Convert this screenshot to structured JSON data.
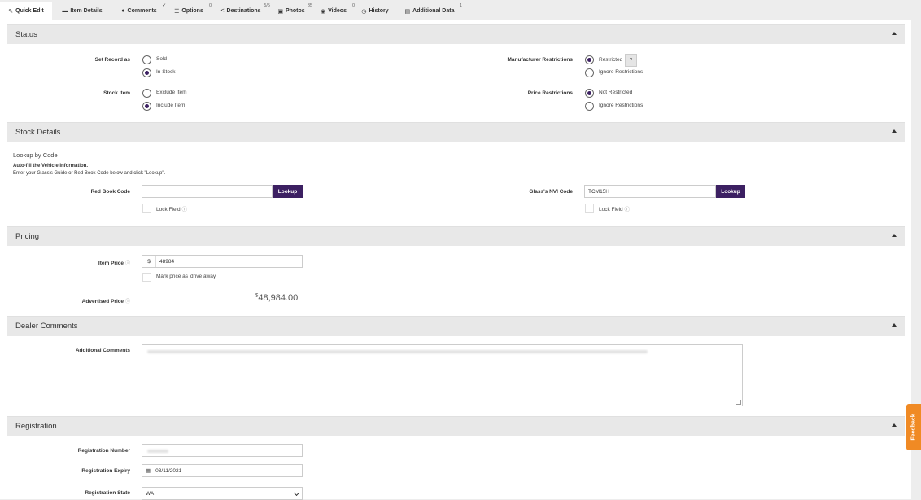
{
  "tabs": [
    {
      "label": "Quick Edit",
      "icon": "edit-icon",
      "glyph": "✎",
      "badge": ""
    },
    {
      "label": "Item Details",
      "icon": "car-icon",
      "glyph": "▬",
      "badge": ""
    },
    {
      "label": "Comments",
      "icon": "comment-icon",
      "glyph": "●",
      "badge": "✔"
    },
    {
      "label": "Options",
      "icon": "list-icon",
      "glyph": "☰",
      "badge": "0"
    },
    {
      "label": "Destinations",
      "icon": "share-icon",
      "glyph": "<",
      "badge": "5/5"
    },
    {
      "label": "Photos",
      "icon": "image-icon",
      "glyph": "▣",
      "badge": "35"
    },
    {
      "label": "Videos",
      "icon": "play-icon",
      "glyph": "◉",
      "badge": "0"
    },
    {
      "label": "History",
      "icon": "clock-icon",
      "glyph": "◷",
      "badge": ""
    },
    {
      "label": "Additional Data",
      "icon": "data-icon",
      "glyph": "▤",
      "badge": "1"
    }
  ],
  "status": {
    "title": "Status",
    "set_record_label": "Set Record as",
    "sold": "Sold",
    "in_stock": "In Stock",
    "stock_item_label": "Stock Item",
    "exclude_item": "Exclude Item",
    "include_item": "Include Item",
    "manufacturer_label": "Manufacturer Restrictions",
    "restricted": "Restricted",
    "help": "?",
    "ignore_restrictions": "Ignore Restrictions",
    "price_label": "Price Restrictions",
    "not_restricted": "Not Restricted",
    "price_ignore_restrictions": "Ignore Restrictions"
  },
  "stock_details": {
    "title": "Stock Details",
    "lookup_heading": "Lookup by Code",
    "autofill_bold": "Auto-fill the Vehicle Information.",
    "autofill_text": "Enter your Glass's Guide or Red Book Code below and click \"Lookup\".",
    "red_book_label": "Red Book Code",
    "red_book_value": "",
    "lookup": "Lookup",
    "lock_field": "Lock Field",
    "nvi_label": "Glass's NVI Code",
    "nvi_value": "TCM15H"
  },
  "pricing": {
    "title": "Pricing",
    "item_price_label": "Item Price",
    "currency": "$",
    "item_price_value": "48984",
    "drive_away": "Mark price as 'drive away'",
    "advertised_label": "Advertised Price",
    "advertised_currency": "$",
    "advertised_value": "48,984.00"
  },
  "dealer_comments": {
    "title": "Dealer Comments",
    "additional_label": "Additional Comments"
  },
  "registration": {
    "title": "Registration",
    "number_label": "Registration Number",
    "expiry_label": "Registration Expiry",
    "expiry_value": "03/11/2021",
    "state_label": "Registration State",
    "state_value": "WA"
  },
  "feedback": "Feedback",
  "colors": {
    "accent": "#3c2062",
    "feedback": "#f08a24"
  }
}
